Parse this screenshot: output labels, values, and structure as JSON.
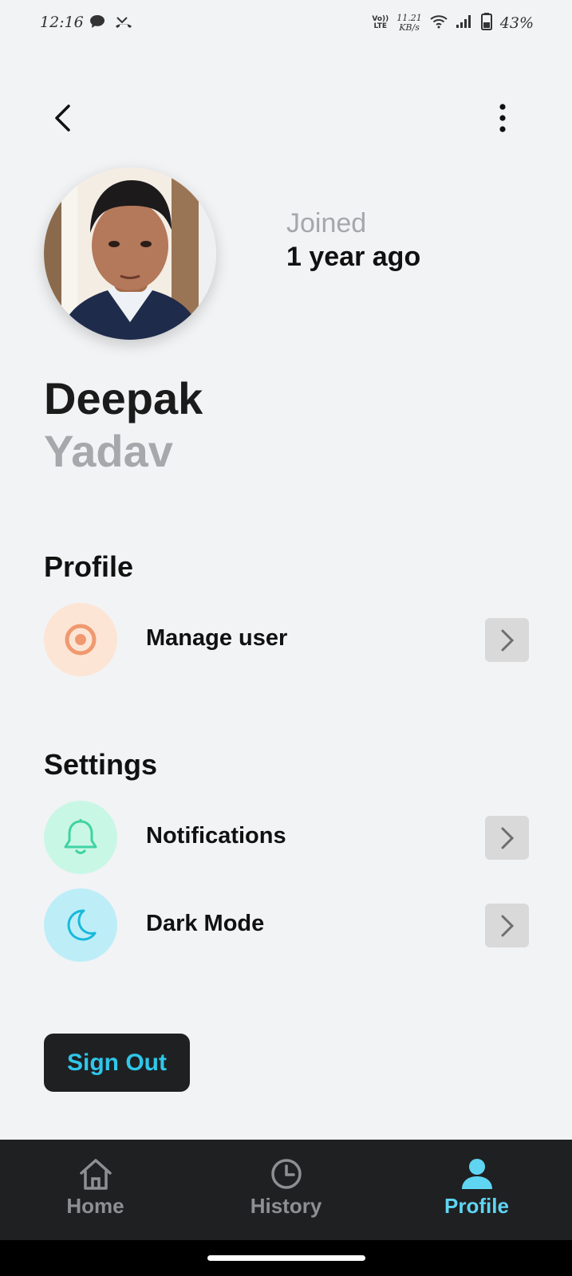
{
  "status_bar": {
    "time": "12:16",
    "volte_top": "Vo))",
    "volte_bottom": "LTE",
    "net_speed_value": "11.21",
    "net_speed_unit": "KB/s",
    "battery_percent": "43%"
  },
  "profile": {
    "joined_label": "Joined",
    "joined_value": "1 year ago",
    "first_name": "Deepak",
    "last_name": "Yadav"
  },
  "sections": {
    "profile_title": "Profile",
    "settings_title": "Settings"
  },
  "rows": {
    "manage_user": {
      "label": "Manage user",
      "icon": "target-icon",
      "icon_bg": "#fde5d6",
      "icon_color": "#f0996f"
    },
    "notifications": {
      "label": "Notifications",
      "icon": "bell-icon",
      "icon_bg": "#c9f7e6",
      "icon_color": "#3fd3a2"
    },
    "dark_mode": {
      "label": "Dark Mode",
      "icon": "moon-icon",
      "icon_bg": "#bdeef8",
      "icon_color": "#18b9dc"
    }
  },
  "signout_label": "Sign Out",
  "bottom_nav": {
    "items": [
      {
        "label": "Home",
        "icon": "home-icon",
        "active": false
      },
      {
        "label": "History",
        "icon": "clock-icon",
        "active": false
      },
      {
        "label": "Profile",
        "icon": "person-icon",
        "active": true
      }
    ]
  },
  "colors": {
    "accent": "#2fc7ea",
    "background": "#f2f3f5",
    "nav_background": "#1f2022",
    "nav_inactive": "#8e8f93"
  }
}
